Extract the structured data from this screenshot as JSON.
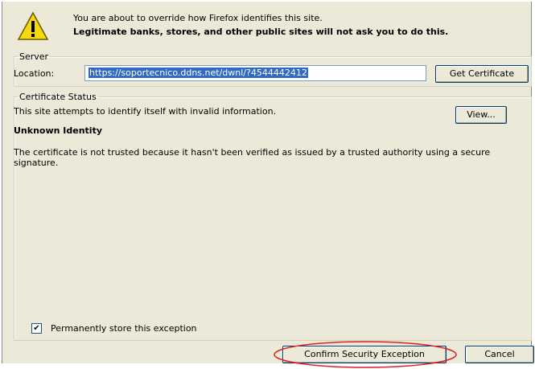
{
  "header": {
    "line1": "You are about to override how Firefox identifies this site.",
    "line2": "Legitimate banks, stores, and other public sites will not ask you to do this."
  },
  "server": {
    "legend": "Server",
    "location_label": "Location:",
    "location_value": "https://soportecnico.ddns.net/dwnl/?4544442412",
    "get_certificate_label": "Get Certificate"
  },
  "status": {
    "legend": "Certificate Status",
    "message": "This site attempts to identify itself with invalid information.",
    "view_label": "View...",
    "identity_title": "Unknown Identity",
    "description": "The certificate is not trusted because it hasn't been verified as issued by a trusted authority using a secure signature."
  },
  "permanent": {
    "label": "Permanently store this exception",
    "checked": true
  },
  "buttons": {
    "confirm_label": "Confirm Security Exception",
    "cancel_label": "Cancel"
  },
  "colors": {
    "dialog_bg": "#ece9d8",
    "selection": "#316ac5",
    "highlight_ellipse": "#e02020",
    "warning_yellow": "#f5d90a"
  },
  "icons": {
    "warning": "warning-triangle-icon",
    "check": "checkmark-icon"
  }
}
